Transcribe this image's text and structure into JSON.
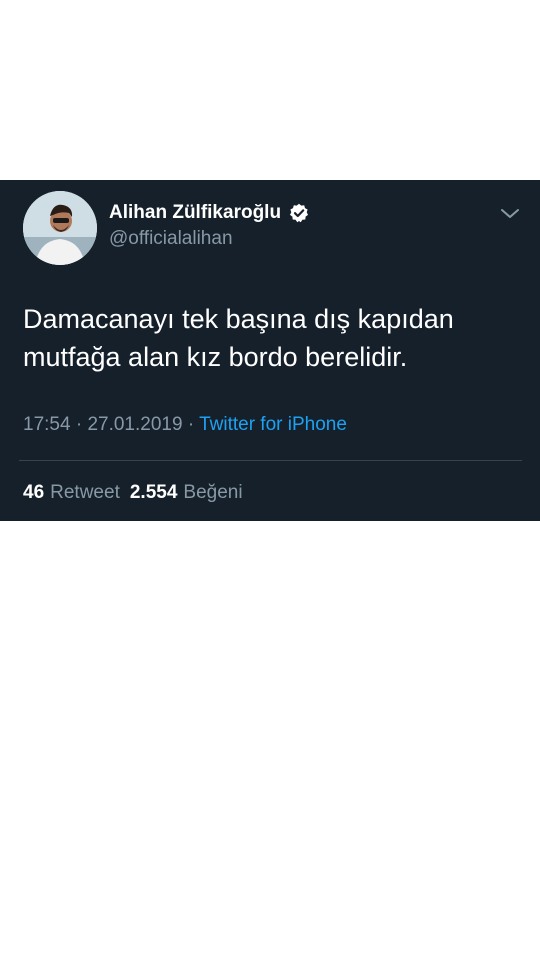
{
  "tweet": {
    "author": {
      "display_name": "Alihan Zülfikaroğlu",
      "handle": "@officialalihan",
      "verified": true
    },
    "text_line1": "Damacanayı tek başına dış kapıdan",
    "text_line2": "mutfağa alan kız bordo berelidir.",
    "time": "17:54",
    "separator1": "·",
    "date": "27.01.2019",
    "separator2": "·",
    "source": "Twitter for iPhone",
    "stats": {
      "retweets_count": "46",
      "retweets_label": "Retweet",
      "likes_count": "2.554",
      "likes_label": "Beğeni"
    }
  },
  "colors": {
    "card_background": "#15202b",
    "secondary_text": "#8899a6",
    "link": "#1da1f2",
    "verified_badge": "#ffffff",
    "divider": "#38444d"
  },
  "icons": {
    "verified": "verified-badge-icon",
    "menu": "chevron-down-icon"
  }
}
